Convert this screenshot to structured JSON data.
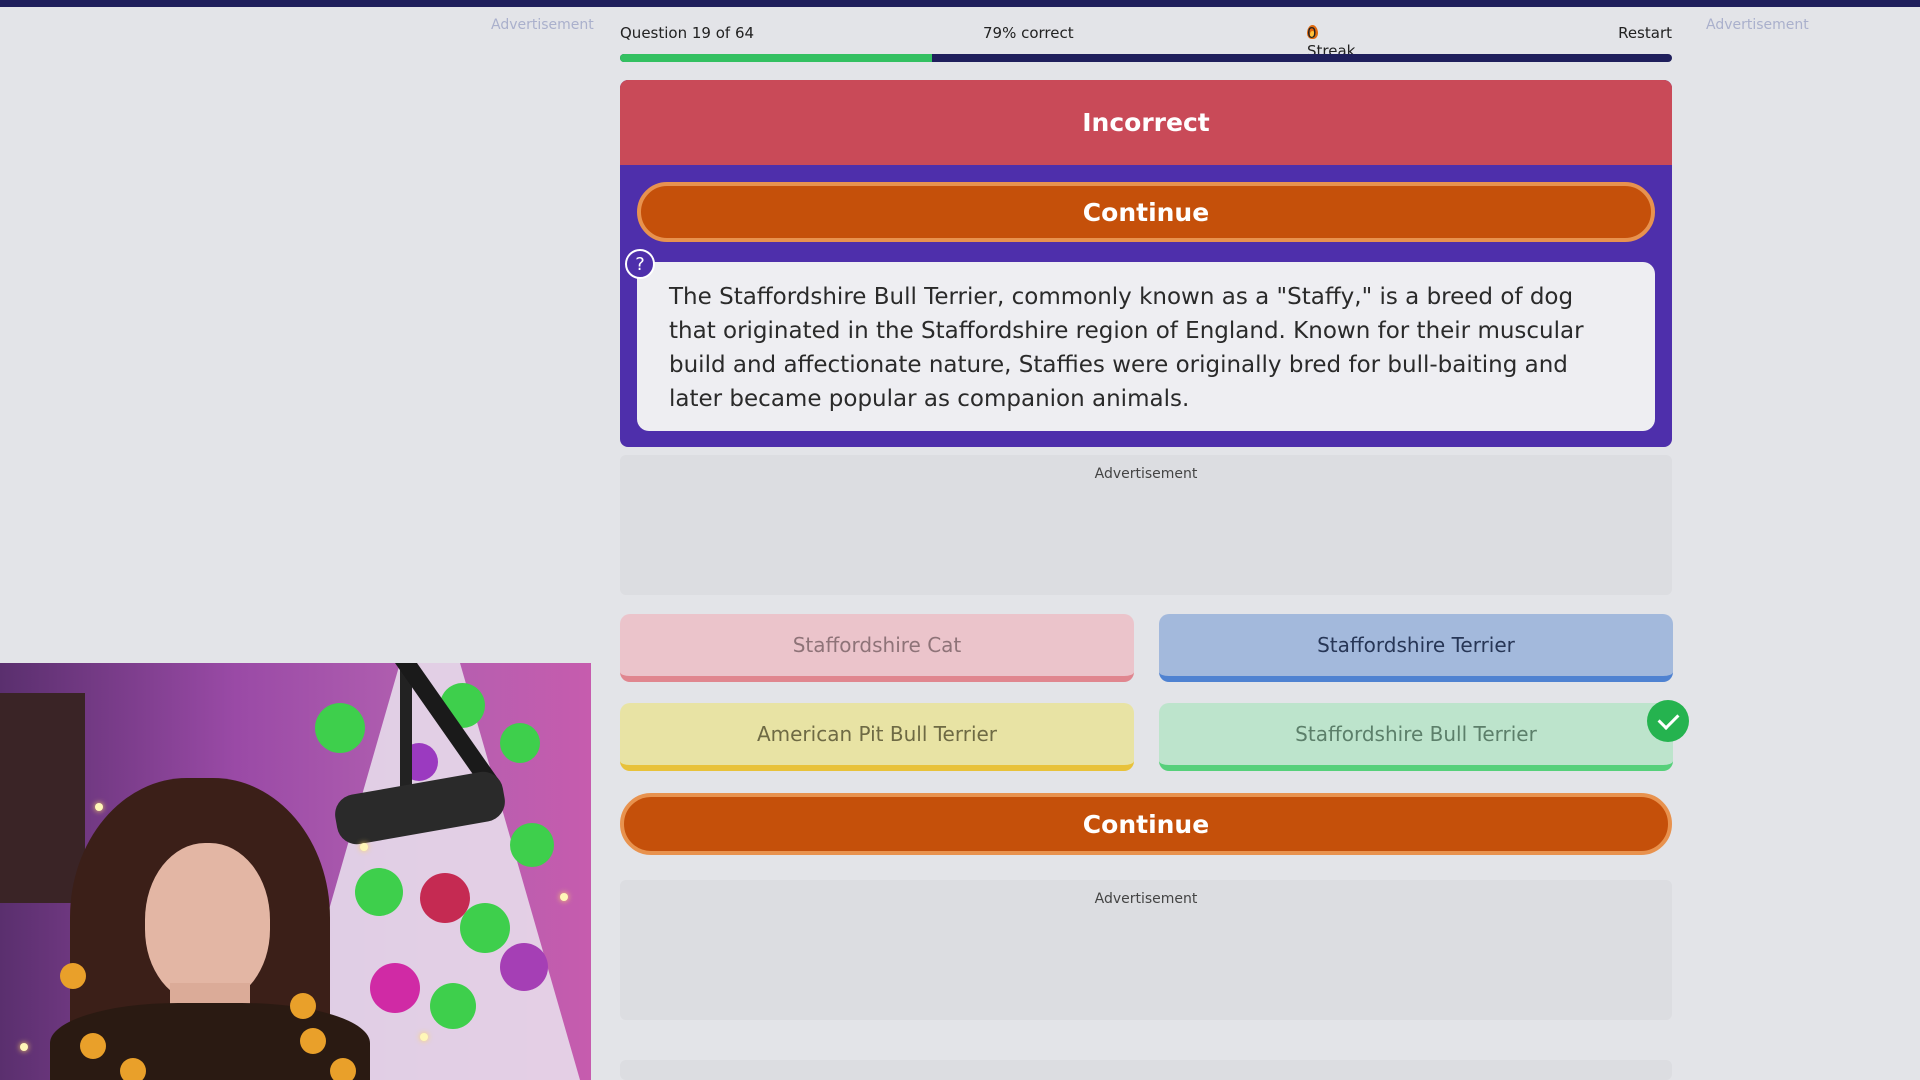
{
  "page": {
    "side_ad_left": "Advertisement",
    "side_ad_right": "Advertisement"
  },
  "status": {
    "question": "Question 19 of 64",
    "percent_correct": "79% correct",
    "streak": "0 Streak",
    "restart": "Restart",
    "progress_fraction": 0.297
  },
  "result": {
    "title": "Incorrect",
    "continue_label": "Continue",
    "help_icon": "?",
    "explanation": "The Staffordshire Bull Terrier, commonly known as a \"Staffy,\" is a breed of dog that originated in the Staffordshire region of England. Known for their muscular build and affectionate nature, Staffies were originally bred for bull-baiting and later became popular as companion animals."
  },
  "ads": {
    "ad1": "Advertisement",
    "ad2": "Advertisement"
  },
  "answers": [
    {
      "label": "Staffordshire Cat",
      "state": "dimmed"
    },
    {
      "label": "Staffordshire Terrier",
      "state": "selected-wrong"
    },
    {
      "label": "American Pit Bull Terrier",
      "state": "dimmed"
    },
    {
      "label": "Staffordshire Bull Terrier",
      "state": "correct"
    }
  ],
  "bottom_continue_label": "Continue",
  "colors": {
    "header_incorrect": "#c94a58",
    "card_bg": "#4e2fab",
    "continue_orange": "#c5500a",
    "progress_green": "#33c061",
    "progress_track": "#1f1f5c"
  },
  "icons": {
    "streak": "flame-icon",
    "help": "question-circle-icon",
    "correct": "check-circle-icon"
  }
}
